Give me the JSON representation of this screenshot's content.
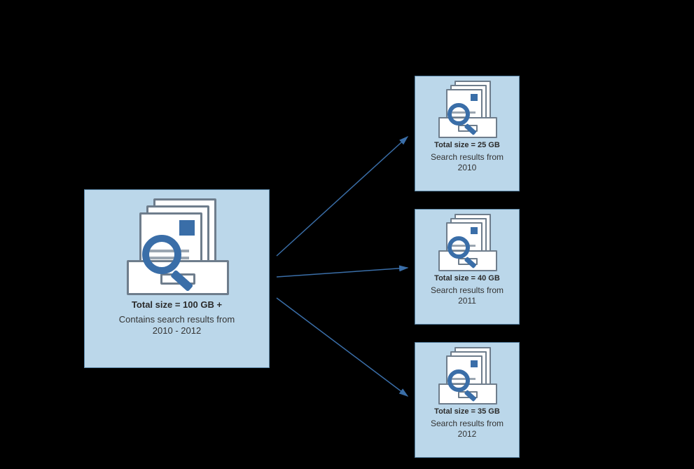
{
  "big": {
    "size_label": "Total size = 100 GB +",
    "desc_line1": "Contains search results from",
    "desc_line2": "2010 - 2012"
  },
  "small": [
    {
      "size_label": "Total size = 25 GB",
      "desc_line1": "Search results from",
      "desc_line2": "2010"
    },
    {
      "size_label": "Total size = 40 GB",
      "desc_line1": "Search results from",
      "desc_line2": "2011"
    },
    {
      "size_label": "Total size = 35 GB",
      "desc_line1": "Search results from",
      "desc_line2": "2012"
    }
  ]
}
